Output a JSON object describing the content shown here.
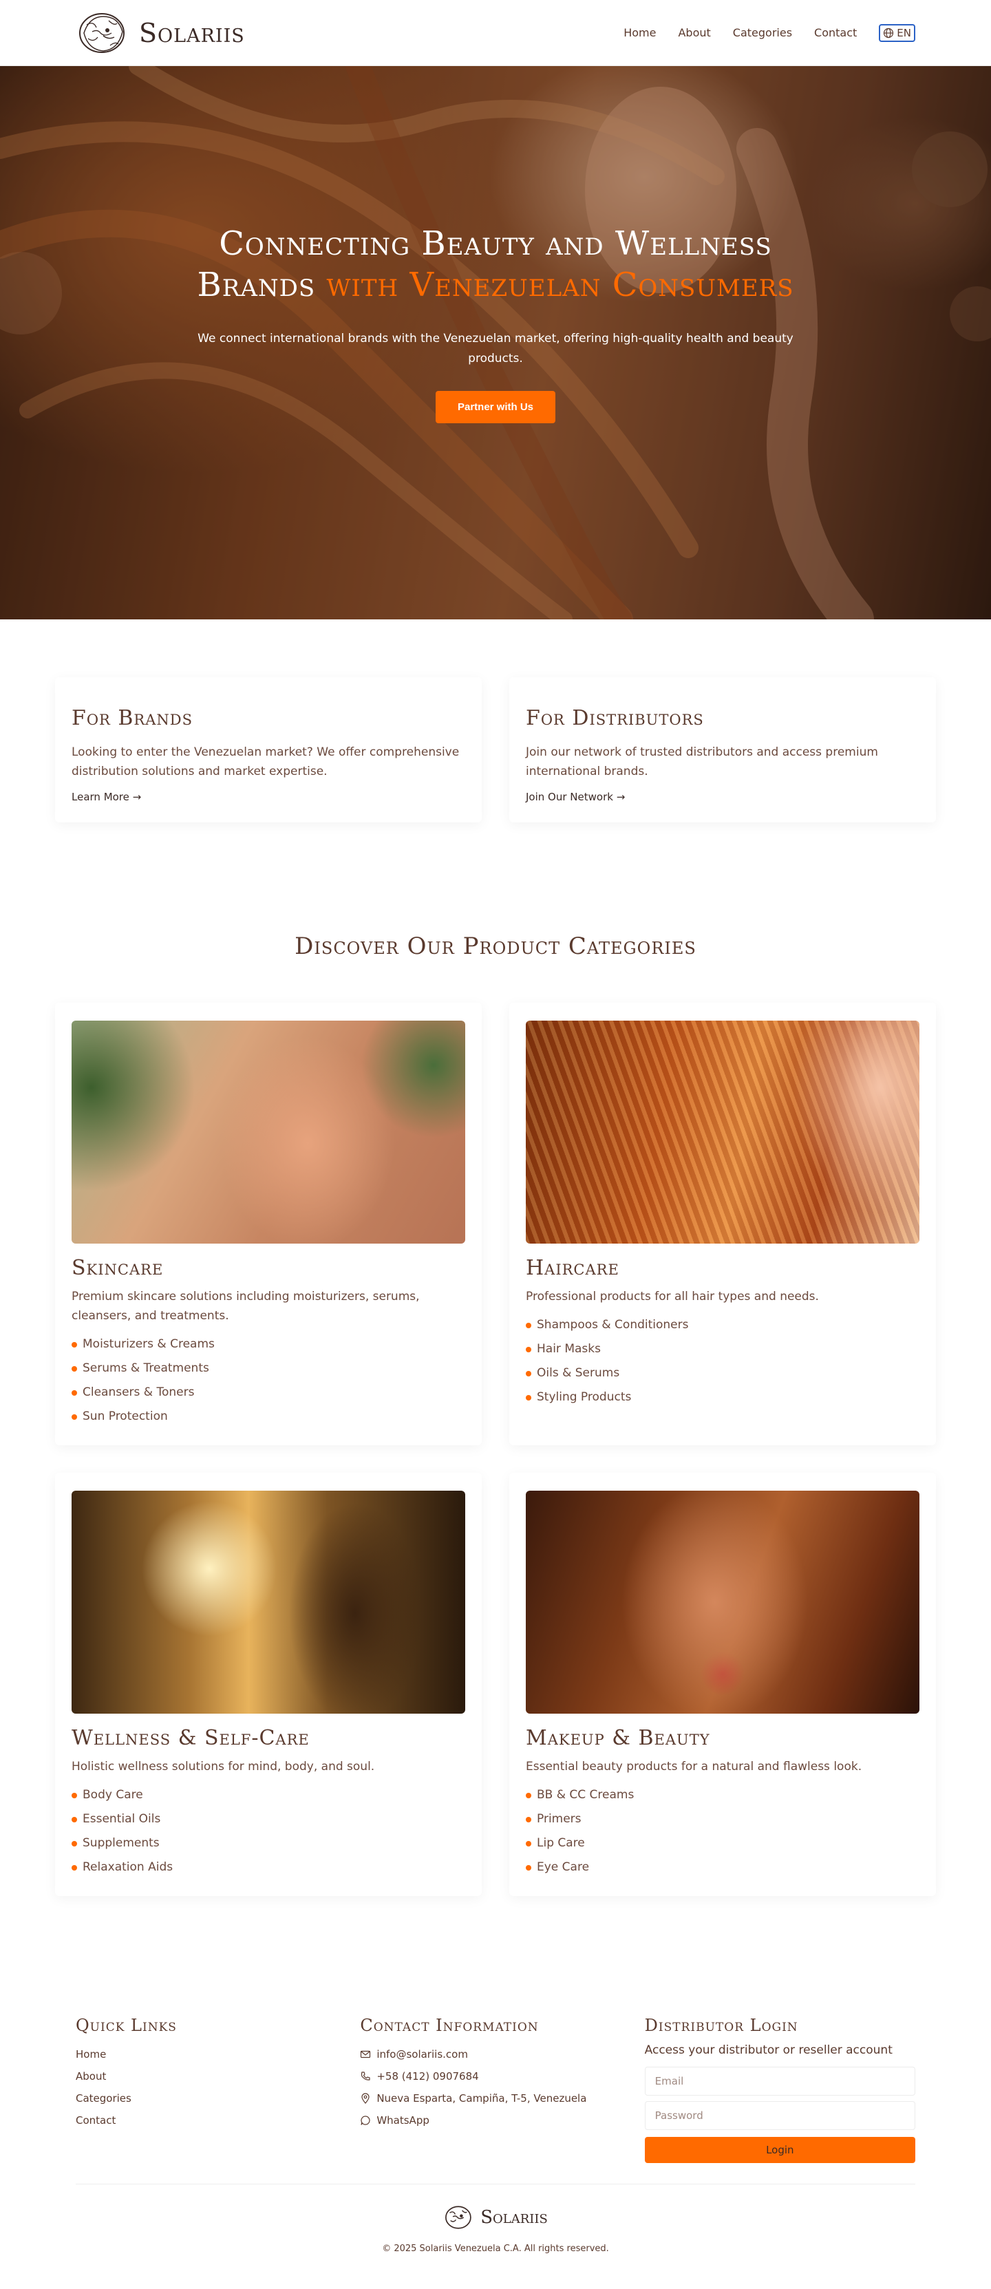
{
  "nav": {
    "brand": "Solariis",
    "links": [
      "Home",
      "About",
      "Categories",
      "Contact"
    ],
    "lang": "EN"
  },
  "hero": {
    "title_line1": "Connecting Beauty and Wellness",
    "title_line2": "Brands",
    "title_accent": "with Venezuelan Consumers",
    "subtitle": "We connect international brands with the Venezuelan market, offering high-quality health and beauty products.",
    "cta": "Partner with Us"
  },
  "audience": [
    {
      "title": "For Brands",
      "text": "Looking to enter the Venezuelan market? We offer comprehensive distribution solutions and market expertise.",
      "link": "Learn More →"
    },
    {
      "title": "For Distributors",
      "text": "Join our network of trusted distributors and access premium international brands.",
      "link": "Join Our Network →"
    }
  ],
  "categories": {
    "title": "Discover Our Product Categories",
    "items": [
      {
        "title": "Skincare",
        "desc": "Premium skincare solutions including moisturizers, serums, cleansers, and treatments.",
        "list": [
          "Moisturizers & Creams",
          "Serums & Treatments",
          "Cleansers & Toners",
          "Sun Protection"
        ]
      },
      {
        "title": "Haircare",
        "desc": "Professional products for all hair types and needs.",
        "list": [
          "Shampoos & Conditioners",
          "Hair Masks",
          "Oils & Serums",
          "Styling Products"
        ]
      },
      {
        "title": "Wellness & Self-Care",
        "desc": "Holistic wellness solutions for mind, body, and soul.",
        "list": [
          "Body Care",
          "Essential Oils",
          "Supplements",
          "Relaxation Aids"
        ]
      },
      {
        "title": "Makeup & Beauty",
        "desc": "Essential beauty products for a natural and flawless look.",
        "list": [
          "BB & CC Creams",
          "Primers",
          "Lip Care",
          "Eye Care"
        ]
      }
    ]
  },
  "footer": {
    "quick_links_title": "Quick Links",
    "quick_links": [
      "Home",
      "About",
      "Categories",
      "Contact"
    ],
    "contact_title": "Contact Information",
    "email": "info@solariis.com",
    "phone": "+58 (412) 0907684",
    "address": "Nueva Esparta, Campiña, T-5, Venezuela",
    "whatsapp": "WhatsApp",
    "login_title": "Distributor Login",
    "login_text": "Access your distributor or reseller account",
    "email_placeholder": "Email",
    "password_placeholder": "Password",
    "login_button": "Login",
    "brand": "Solariis",
    "copyright": "© 2025 Solariis Venezuela C.A. All rights reserved."
  },
  "colors": {
    "accent": "#ff6a00",
    "text": "#5a3a2e"
  },
  "icons": {
    "logo": "lion-logo-icon",
    "lang": "globe-icon",
    "email": "mail-icon",
    "phone": "phone-icon",
    "address": "map-pin-icon",
    "whatsapp": "chat-bubble-icon"
  }
}
